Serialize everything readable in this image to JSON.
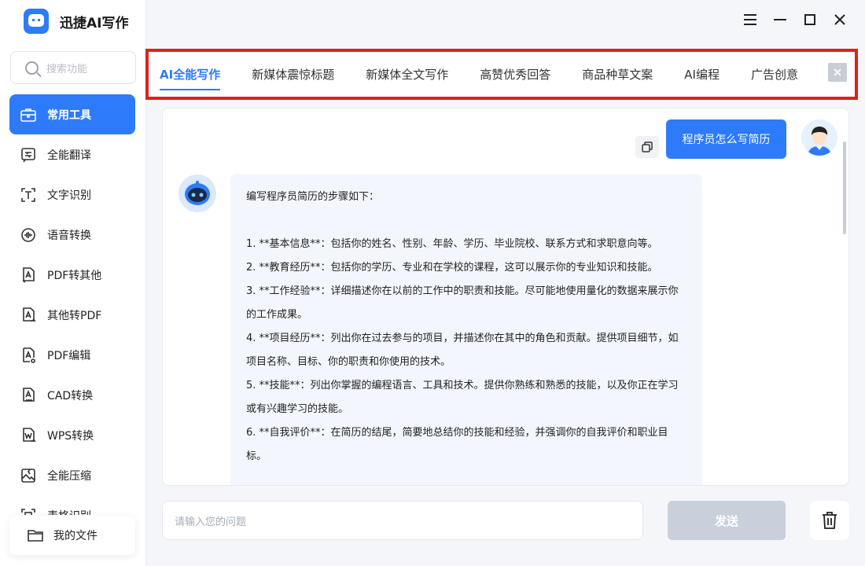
{
  "app": {
    "title": "迅捷AI写作"
  },
  "search": {
    "placeholder": "搜索功能"
  },
  "sidebar": {
    "items": [
      {
        "label": "常用工具",
        "icon": "toolbox-icon",
        "active": true
      },
      {
        "label": "全能翻译",
        "icon": "translate-icon"
      },
      {
        "label": "文字识别",
        "icon": "text-recognition-icon"
      },
      {
        "label": "语音转换",
        "icon": "voice-icon"
      },
      {
        "label": "PDF转其他",
        "icon": "pdf-convert-icon"
      },
      {
        "label": "其他转PDF",
        "icon": "to-pdf-icon"
      },
      {
        "label": "PDF编辑",
        "icon": "pdf-edit-icon"
      },
      {
        "label": "CAD转换",
        "icon": "cad-icon"
      },
      {
        "label": "WPS转换",
        "icon": "wps-icon"
      },
      {
        "label": "全能压缩",
        "icon": "compress-icon"
      },
      {
        "label": "表格识别",
        "icon": "table-recognition-icon"
      }
    ],
    "my_files": "我的文件"
  },
  "tabs": [
    {
      "label": "AI全能写作",
      "active": true
    },
    {
      "label": "新媒体震惊标题"
    },
    {
      "label": "新媒体全文写作"
    },
    {
      "label": "高赞优秀回答"
    },
    {
      "label": "商品种草文案"
    },
    {
      "label": "AI编程"
    },
    {
      "label": "广告创意"
    }
  ],
  "chat": {
    "user_message": "程序员怎么写简历",
    "bot_intro": "编写程序员简历的步骤如下：",
    "bot_lines": [
      "1. **基本信息**：包括你的姓名、性别、年龄、学历、毕业院校、联系方式和求职意向等。",
      "2. **教育经历**：包括你的学历、专业和在学校的课程，这可以展示你的专业知识和技能。",
      "3. **工作经验**：详细描述你在以前的工作中的职责和技能。尽可能地使用量化的数据来展示你的工作成果。",
      "4. **项目经历**：列出你在过去参与的项目，并描述你在其中的角色和贡献。提供项目细节，如项目名称、目标、你的职责和你使用的技术。",
      "5. **技能**：列出你掌握的编程语言、工具和技术。提供你熟练和熟悉的技能，以及你正在学习或有兴趣学习的技能。",
      "6. **自我评价**：在简历的结尾，简要地总结你的技能和经验，并强调你的自我评价和职业目标。"
    ]
  },
  "input": {
    "placeholder": "请输入您的问题"
  },
  "send_label": "发送",
  "colors": {
    "accent": "#2d7bfa",
    "highlight_border": "#e0201c"
  }
}
